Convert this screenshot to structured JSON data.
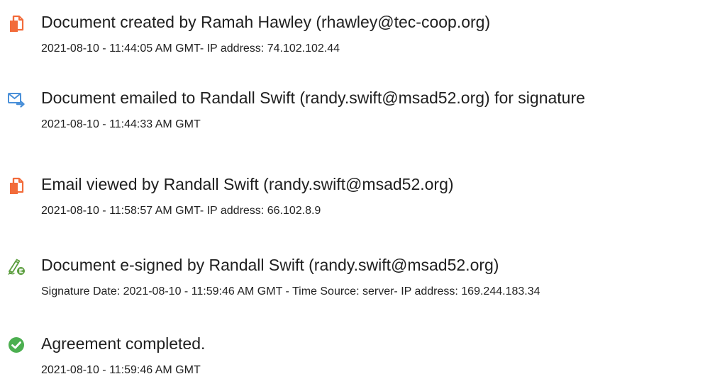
{
  "events": [
    {
      "icon": "document-icon",
      "title": "Document created by Ramah Hawley (rhawley@tec-coop.org)",
      "detail": "2021-08-10 - 11:44:05 AM GMT- IP address: 74.102.102.44"
    },
    {
      "icon": "email-sent-icon",
      "title": "Document emailed to Randall Swift (randy.swift@msad52.org) for signature",
      "detail": "2021-08-10 - 11:44:33 AM GMT"
    },
    {
      "icon": "document-icon",
      "title": "Email viewed by Randall Swift (randy.swift@msad52.org)",
      "detail": "2021-08-10 - 11:58:57 AM GMT- IP address: 66.102.8.9"
    },
    {
      "icon": "e-sign-pen-icon",
      "title": "Document e-signed by Randall Swift (randy.swift@msad52.org)",
      "detail": "Signature Date: 2021-08-10 - 11:59:46 AM GMT - Time Source: server- IP address: 169.244.183.34"
    },
    {
      "icon": "check-circle-icon",
      "title": "Agreement completed.",
      "detail": "2021-08-10 - 11:59:46 AM GMT"
    }
  ],
  "colors": {
    "document_icon": "#f26b3a",
    "email_icon": "#4a90d9",
    "esign_icon": "#5c9e3f",
    "check_icon": "#4caf50",
    "text": "#202020"
  }
}
